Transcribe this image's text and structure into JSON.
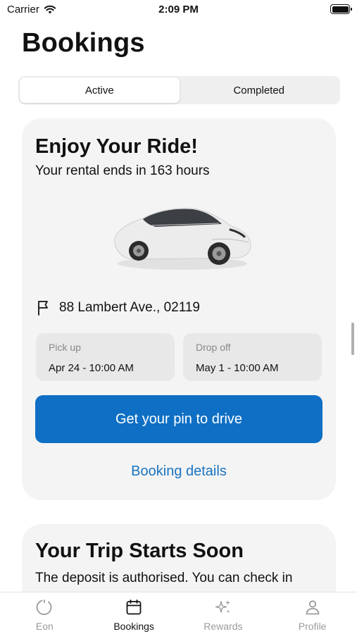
{
  "status_bar": {
    "carrier": "Carrier",
    "time": "2:09 PM"
  },
  "page": {
    "title": "Bookings"
  },
  "segments": [
    {
      "label": "Active",
      "selected": true
    },
    {
      "label": "Completed",
      "selected": false
    }
  ],
  "active_booking": {
    "title": "Enjoy Your Ride!",
    "subtitle": "Your rental ends in 163 hours",
    "address": "88 Lambert Ave., 02119",
    "pickup": {
      "label": "Pick up",
      "value": "Apr 24 - 10:00 AM"
    },
    "dropoff": {
      "label": "Drop off",
      "value": "May 1 - 10:00 AM"
    },
    "primary_action": "Get your pin to drive",
    "secondary_action": "Booking details"
  },
  "upcoming_booking": {
    "title": "Your Trip Starts Soon",
    "subtitle": "The deposit is authorised. You can check in"
  },
  "tab_bar": {
    "tabs": [
      {
        "label": "Eon",
        "icon": "loading-circle-icon",
        "selected": false
      },
      {
        "label": "Bookings",
        "icon": "calendar-icon",
        "selected": true
      },
      {
        "label": "Rewards",
        "icon": "sparkles-icon",
        "selected": false
      },
      {
        "label": "Profile",
        "icon": "person-icon",
        "selected": false
      }
    ]
  },
  "colors": {
    "primary": "#0e6fc4",
    "link": "#1a73c0",
    "card_background": "#f4f4f4",
    "inactive_tab": "#9a9a9a"
  }
}
